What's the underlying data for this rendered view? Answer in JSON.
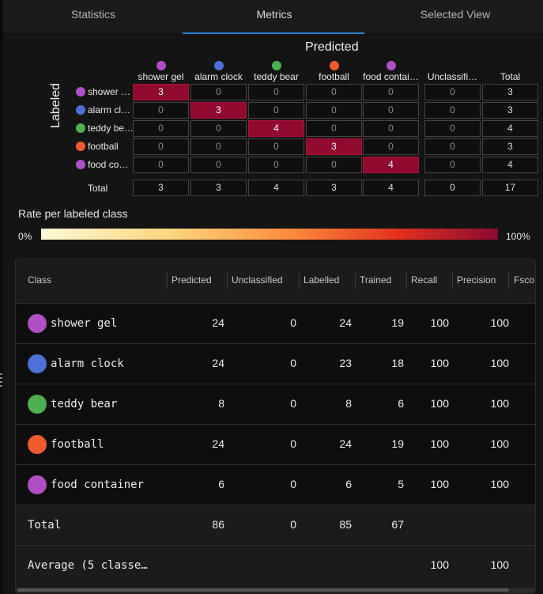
{
  "tabs": [
    "Statistics",
    "Metrics",
    "Selected View"
  ],
  "active_tab": "Metrics",
  "matrix": {
    "predicted_title": "Predicted",
    "labeled_title": "Labeled",
    "columns": [
      {
        "label": "shower gel",
        "color": "#b04fc4"
      },
      {
        "label": "alarm clock",
        "color": "#4f6fd8"
      },
      {
        "label": "teddy bear",
        "color": "#4caf50"
      },
      {
        "label": "football",
        "color": "#f05a2e"
      },
      {
        "label": "food contai…",
        "color": "#b04fc4"
      },
      {
        "label": "Unclassifi…",
        "color": ""
      },
      {
        "label": "Total",
        "color": ""
      }
    ],
    "rows": [
      {
        "label": "shower …",
        "color": "#b04fc4",
        "values": [
          "3",
          "0",
          "0",
          "0",
          "0",
          "0",
          "3"
        ]
      },
      {
        "label": "alarm cl…",
        "color": "#4f6fd8",
        "values": [
          "0",
          "3",
          "0",
          "0",
          "0",
          "0",
          "3"
        ]
      },
      {
        "label": "teddy be…",
        "color": "#4caf50",
        "values": [
          "0",
          "0",
          "4",
          "0",
          "0",
          "0",
          "4"
        ]
      },
      {
        "label": "football",
        "color": "#f05a2e",
        "values": [
          "0",
          "0",
          "0",
          "3",
          "0",
          "0",
          "3"
        ]
      },
      {
        "label": "food co…",
        "color": "#b04fc4",
        "values": [
          "0",
          "0",
          "0",
          "0",
          "4",
          "0",
          "4"
        ]
      }
    ],
    "total_row": {
      "label": "Total",
      "values": [
        "3",
        "3",
        "4",
        "3",
        "4",
        "0",
        "17"
      ]
    }
  },
  "rate": {
    "title": "Rate per labeled class",
    "min_label": "0%",
    "max_label": "100%"
  },
  "table": {
    "headers": [
      "Class",
      "Predicted",
      "Unclassified",
      "Labelled",
      "Trained",
      "Recall",
      "Precision",
      "Fsco"
    ],
    "rows": [
      {
        "name": "shower gel",
        "color": "#b04fc4",
        "values": [
          "24",
          "0",
          "24",
          "19",
          "100",
          "100"
        ]
      },
      {
        "name": "alarm clock",
        "color": "#4f6fd8",
        "values": [
          "24",
          "0",
          "23",
          "18",
          "100",
          "100"
        ]
      },
      {
        "name": "teddy bear",
        "color": "#4caf50",
        "values": [
          "8",
          "0",
          "8",
          "6",
          "100",
          "100"
        ]
      },
      {
        "name": "football",
        "color": "#f05a2e",
        "values": [
          "24",
          "0",
          "24",
          "19",
          "100",
          "100"
        ]
      },
      {
        "name": "food container",
        "color": "#b04fc4",
        "values": [
          "6",
          "0",
          "6",
          "5",
          "100",
          "100"
        ]
      }
    ],
    "total": {
      "name": "Total",
      "values": [
        "86",
        "0",
        "85",
        "67",
        "",
        ""
      ]
    },
    "average": {
      "name": "Average (5 classe…",
      "values": [
        "",
        "",
        "",
        "",
        "100",
        "100"
      ]
    }
  }
}
